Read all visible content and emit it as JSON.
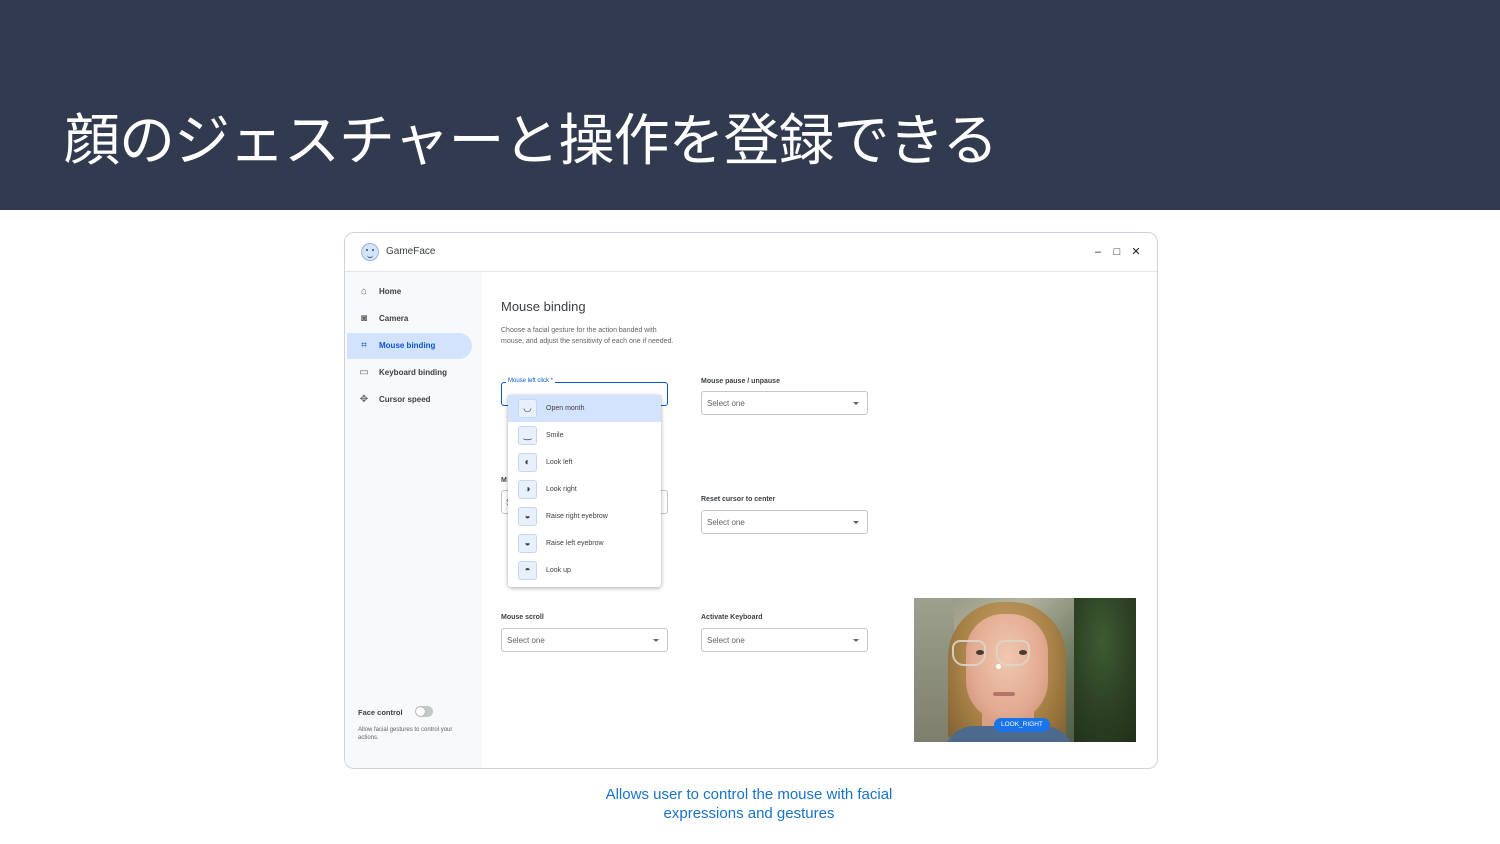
{
  "slide": {
    "title": "顔のジェスチャーと操作を登録できる",
    "caption": "Allows user to control the mouse with facial expressions and gestures"
  },
  "window": {
    "app_name": "GameFace",
    "controls": {
      "minimize": "–",
      "maximize": "□",
      "close": "✕"
    }
  },
  "sidebar": {
    "items": [
      {
        "label": "Home",
        "icon": "home-icon",
        "glyph": "⌂",
        "active": false
      },
      {
        "label": "Camera",
        "icon": "camera-icon",
        "glyph": "◙",
        "active": false
      },
      {
        "label": "Mouse binding",
        "icon": "mouse-icon",
        "glyph": "⌗",
        "active": true
      },
      {
        "label": "Keyboard binding",
        "icon": "keyboard-icon",
        "glyph": "▭",
        "active": false
      },
      {
        "label": "Cursor speed",
        "icon": "move-icon",
        "glyph": "✥",
        "active": false
      }
    ],
    "face_control": {
      "label": "Face control",
      "enabled": false,
      "description": "Allow facial gestures to control your actions."
    }
  },
  "main": {
    "title": "Mouse binding",
    "description": "Choose a facial gesture for the action banded with mouse, and adjust the sensitivity of each one if needed.",
    "fields": {
      "left_click": {
        "label": "Mouse left click *",
        "value": ""
      },
      "partial_label": "M",
      "partial_value": "S",
      "pause": {
        "label": "Mouse pause / unpause",
        "value": "Select one"
      },
      "reset": {
        "label": "Reset cursor to center",
        "value": "Select one"
      },
      "scroll": {
        "label": "Mouse scroll",
        "value": "Select one"
      },
      "keyboard": {
        "label": "Activate Keyboard",
        "value": "Select one"
      }
    },
    "dropdown": {
      "options": [
        {
          "label": "Open month",
          "icon": "open-mouth-icon",
          "glyph": "◡",
          "highlighted": true
        },
        {
          "label": "Smile",
          "icon": "smile-icon",
          "glyph": "‿",
          "highlighted": false
        },
        {
          "label": "Look left",
          "icon": "look-left-icon",
          "glyph": "◐",
          "highlighted": false
        },
        {
          "label": "Look right",
          "icon": "look-right-icon",
          "glyph": "◑",
          "highlighted": false
        },
        {
          "label": "Raise right eyebrow",
          "icon": "raise-right-eyebrow-icon",
          "glyph": "◒",
          "highlighted": false
        },
        {
          "label": "Raise left eyebrow",
          "icon": "raise-left-eyebrow-icon",
          "glyph": "◒",
          "highlighted": false
        },
        {
          "label": "Look up",
          "icon": "look-up-icon",
          "glyph": "◓",
          "highlighted": false
        }
      ]
    },
    "camera_preview": {
      "detected_gesture": "LOOK_RIGHT"
    }
  },
  "colors": {
    "banner": "#313a4e",
    "accent": "#0b57d0",
    "active_nav": "#d3e3fd",
    "caption": "#1a73c8"
  }
}
